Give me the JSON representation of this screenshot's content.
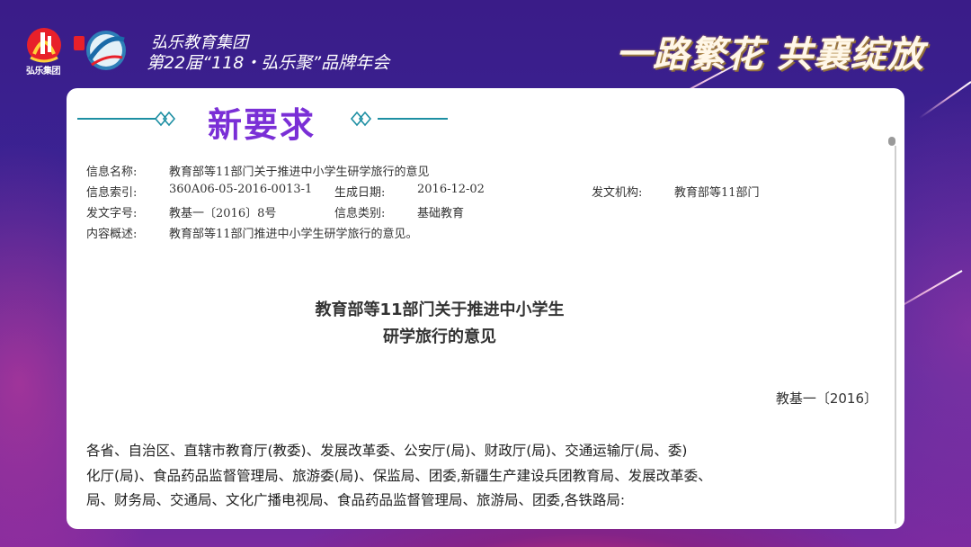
{
  "header": {
    "logo_caption": "弘乐集团",
    "org_name": "弘乐教育集团",
    "event_name": "第22届“118・弘乐聚”品牌年会",
    "slogan": "一路繁花 共襄绽放"
  },
  "section": {
    "title": "新要求"
  },
  "meta": {
    "name_label": "信息名称:",
    "name_value": "教育部等11部门关于推进中小学生研学旅行的意见",
    "index_label": "信息索引:",
    "index_value": "360A06-05-2016-0013-1",
    "date_label": "生成日期:",
    "date_value": "2016-12-02",
    "issuer_label": "发文机构:",
    "issuer_value": "教育部等11部门",
    "docno_label": "发文字号:",
    "docno_value": "教基一〔2016〕8号",
    "category_label": "信息类别:",
    "category_value": "基础教育",
    "summary_label": "内容概述:",
    "summary_value": "教育部等11部门推进中小学生研学旅行的意见。"
  },
  "document": {
    "title_line1": "教育部等11部门关于推进中小学生",
    "title_line2": "研学旅行的意见",
    "number": "教基一〔2016〕",
    "body_line1": "各省、自治区、直辖市教育厅(教委)、发展改革委、公安厅(局)、财政厅(局)、交通运输厅(局、委)",
    "body_line2": "化厅(局)、食品药品监督管理局、旅游委(局)、保监局、团委,新疆生产建设兵团教育局、发展改革委、",
    "body_line3": "局、财务局、交通局、文化广播电视局、食品药品监督管理局、旅游局、团委,各铁路局:"
  },
  "colors": {
    "accent_purple": "#7a2fd6",
    "accent_teal": "#1d8fa3",
    "background": "#3b2496"
  },
  "icons": {
    "logo": "hongle-logo-icon",
    "logo2": "brand-emblem-icon",
    "ornament": "double-diamond-icon"
  }
}
